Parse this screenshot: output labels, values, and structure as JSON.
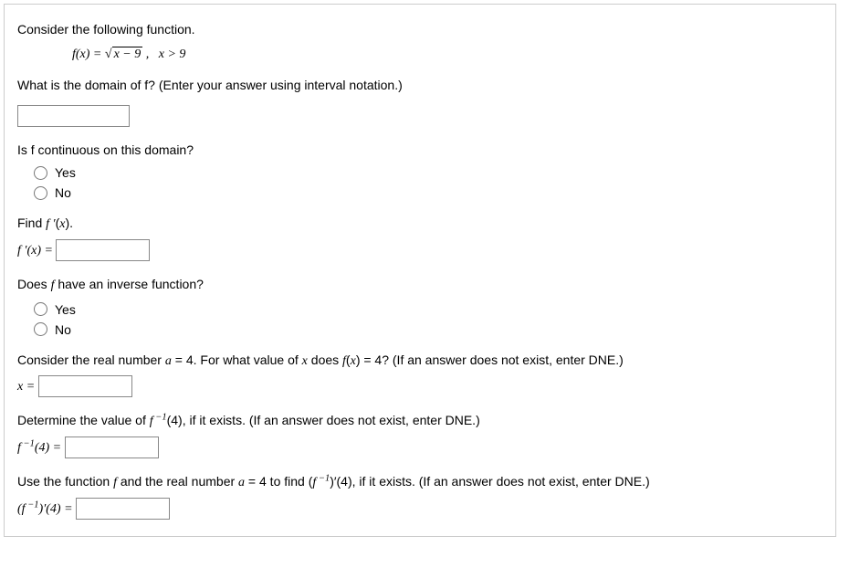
{
  "q1_intro": "Consider the following function.",
  "formula_lhs": "f(x) = ",
  "formula_sqrt_body": "x − 9",
  "formula_cond": ",   x > 9",
  "q1_domain": "What is the domain of f? (Enter your answer using interval notation.)",
  "q2_continuous": "Is f continuous on this domain?",
  "opt_yes": "Yes",
  "opt_no": "No",
  "q3_find": "Find f ′(x).",
  "q3_label": "f ′(x) = ",
  "q4_inverse": "Does f have an inverse function?",
  "q5_consider_a": "Consider the real number ",
  "q5_consider_b": " = 4. For what value of ",
  "q5_consider_c": " does ",
  "q5_consider_d": "(",
  "q5_consider_e": ") = 4? (If an answer does not exist, enter DNE.)",
  "q5_label": "x = ",
  "q6_determine_a": "Determine the value of ",
  "q6_determine_b": "(4), if it exists. (If an answer does not exist, enter DNE.)",
  "q6_label_a": "f",
  "q6_label_b": "(4) = ",
  "q7_use_a": "Use the function ",
  "q7_use_b": " and the real number ",
  "q7_use_c": " = 4 to find (",
  "q7_use_d": ")′(4), if it exists. (If an answer does not exist, enter DNE.)",
  "q7_label_a": "(f",
  "q7_label_b": ")′(4) = ",
  "sup_neg1": "−1",
  "var_a": "a",
  "var_x": "x",
  "var_f": "f"
}
